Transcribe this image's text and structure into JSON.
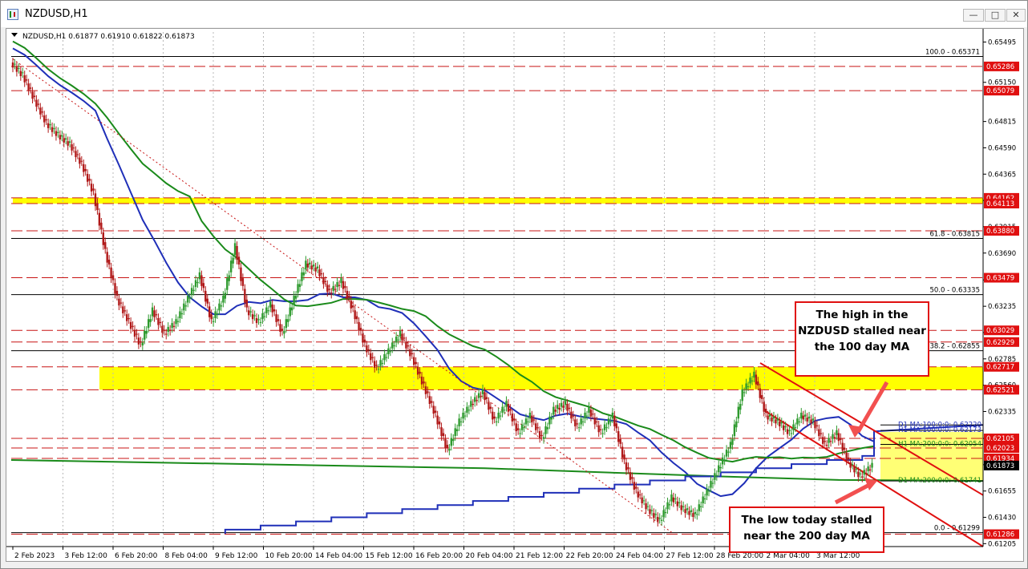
{
  "window": {
    "title": "NZDUSD,H1",
    "buttons": [
      "minimize",
      "maximize",
      "close"
    ]
  },
  "chart_data": {
    "type": "candlestick",
    "symbol_header": "NZDUSD,H1  0.61877 0.61910 0.61822 0.61873",
    "ohlc": {
      "open": 0.61877,
      "high": 0.6191,
      "low": 0.61822,
      "close": 0.61873
    },
    "current_price": "0.61873",
    "x_ticks": [
      "2 Feb 2023",
      "3 Feb 12:00",
      "6 Feb 20:00",
      "8 Feb 04:00",
      "9 Feb 12:00",
      "10 Feb 20:00",
      "14 Feb 04:00",
      "15 Feb 12:00",
      "16 Feb 20:00",
      "20 Feb 04:00",
      "21 Feb 12:00",
      "22 Feb 20:00",
      "24 Feb 04:00",
      "27 Feb 12:00",
      "28 Feb 20:00",
      "2 Mar 04:00",
      "3 Mar 12:00"
    ],
    "y_ticks": [
      "0.65495",
      "0.65150",
      "0.64815",
      "0.64590",
      "0.64365",
      "0.64140",
      "0.63915",
      "0.63690",
      "0.63460",
      "0.63235",
      "0.63010",
      "0.62785",
      "0.62560",
      "0.62335",
      "0.62105",
      "0.61880",
      "0.61655",
      "0.61430",
      "0.61205"
    ],
    "ylim": [
      0.6118,
      0.6558
    ],
    "price_levels": [
      "0.65286",
      "0.65079",
      "0.64162",
      "0.64113",
      "0.63880",
      "0.63479",
      "0.63029",
      "0.62929",
      "0.62717",
      "0.62521",
      "0.62105",
      "0.62023",
      "0.61934",
      "0.61286"
    ],
    "fibonacci": [
      {
        "label": "100.0 - 0.65371",
        "price": 0.65371
      },
      {
        "label": "61.8 - 0.63815",
        "price": 0.63815
      },
      {
        "label": "50.0 - 0.63335",
        "price": 0.63335
      },
      {
        "label": "38.2 - 0.62855",
        "price": 0.62855
      },
      {
        "label": "0.0 - 0.61299",
        "price": 0.61299
      }
    ],
    "ma_labels": [
      {
        "label": "D1 MA:100:0:0: 0.62220",
        "price": 0.6222,
        "color": "#1f2fb8"
      },
      {
        "label": "H1 MA:100:0:0: 0.62173",
        "price": 0.62173,
        "color": "#1f2fb8"
      },
      {
        "label": "H1 MA:200:0:0: 0.62054",
        "price": 0.62054,
        "color": "#1a8a1a"
      },
      {
        "label": "D1 MA:200:0:0: 0.61741",
        "price": 0.61741,
        "color": "#1a8a1a"
      }
    ],
    "price_path": [
      [
        0,
        0.6532
      ],
      [
        1,
        0.6521
      ],
      [
        2,
        0.65
      ],
      [
        3,
        0.648
      ],
      [
        4,
        0.647
      ],
      [
        5,
        0.6462
      ],
      [
        6,
        0.6445
      ],
      [
        7,
        0.642
      ],
      [
        8,
        0.637
      ],
      [
        9,
        0.633
      ],
      [
        10,
        0.631
      ],
      [
        11,
        0.629
      ],
      [
        12,
        0.632
      ],
      [
        13,
        0.63
      ],
      [
        14,
        0.631
      ],
      [
        15,
        0.633
      ],
      [
        16,
        0.635
      ],
      [
        17,
        0.631
      ],
      [
        18,
        0.633
      ],
      [
        19,
        0.6375
      ],
      [
        20,
        0.632
      ],
      [
        21,
        0.631
      ],
      [
        22,
        0.6325
      ],
      [
        23,
        0.63
      ],
      [
        24,
        0.633
      ],
      [
        25,
        0.636
      ],
      [
        26,
        0.6355
      ],
      [
        27,
        0.6335
      ],
      [
        28,
        0.6345
      ],
      [
        29,
        0.632
      ],
      [
        30,
        0.629
      ],
      [
        31,
        0.627
      ],
      [
        32,
        0.6285
      ],
      [
        33,
        0.63
      ],
      [
        34,
        0.628
      ],
      [
        35,
        0.6255
      ],
      [
        36,
        0.623
      ],
      [
        37,
        0.62
      ],
      [
        38,
        0.6225
      ],
      [
        39,
        0.624
      ],
      [
        40,
        0.625
      ],
      [
        41,
        0.6225
      ],
      [
        42,
        0.624
      ],
      [
        43,
        0.6215
      ],
      [
        44,
        0.623
      ],
      [
        45,
        0.621
      ],
      [
        46,
        0.6235
      ],
      [
        47,
        0.624
      ],
      [
        48,
        0.622
      ],
      [
        49,
        0.6235
      ],
      [
        50,
        0.6215
      ],
      [
        51,
        0.623
      ],
      [
        52,
        0.619
      ],
      [
        53,
        0.6165
      ],
      [
        54,
        0.615
      ],
      [
        55,
        0.614
      ],
      [
        56,
        0.616
      ],
      [
        57,
        0.615
      ],
      [
        58,
        0.6145
      ],
      [
        59,
        0.6165
      ],
      [
        60,
        0.6185
      ],
      [
        61,
        0.6205
      ],
      [
        62,
        0.625
      ],
      [
        63,
        0.6265
      ],
      [
        64,
        0.623
      ],
      [
        65,
        0.6225
      ],
      [
        66,
        0.6215
      ],
      [
        67,
        0.623
      ],
      [
        68,
        0.6225
      ],
      [
        69,
        0.6205
      ],
      [
        70,
        0.6215
      ],
      [
        71,
        0.619
      ],
      [
        72,
        0.6178
      ],
      [
        73,
        0.6187
      ]
    ],
    "annotations": [
      {
        "text": [
          "The high in the",
          "NZDUSD stalled near",
          "the 100 day MA"
        ]
      },
      {
        "text": [
          "The low today stalled",
          "near the 200 day MA"
        ]
      }
    ]
  }
}
